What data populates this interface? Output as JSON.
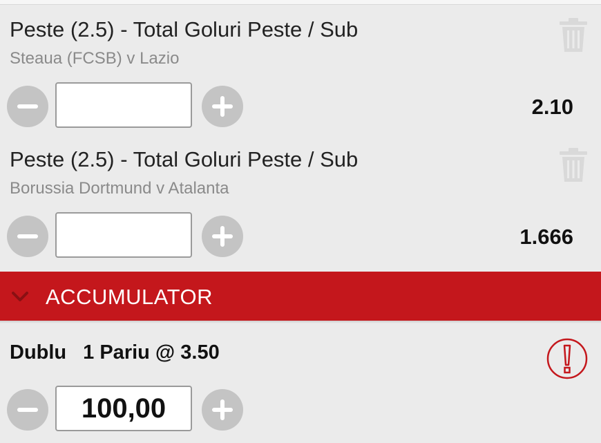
{
  "bets": [
    {
      "market": "Peste (2.5) - Total Goluri Peste / Sub",
      "match": "Steaua (FCSB) v Lazio",
      "stake_value": "",
      "odds": "2.10"
    },
    {
      "market": "Peste (2.5) - Total Goluri Peste / Sub",
      "match": "Borussia Dortmund v Atalanta",
      "stake_value": "",
      "odds": "1.666"
    }
  ],
  "accumulator": {
    "title": "ACCUMULATOR",
    "bet_type": "Dublu",
    "summary": "1 Pariu @ 3.50",
    "stake_value": "100,00"
  },
  "icons": {
    "delete": "trash-icon",
    "decrease": "minus-icon",
    "increase": "plus-icon",
    "collapse": "chevron-down-icon",
    "alert": "exclamation-icon"
  },
  "colors": {
    "accent": "#c4171c",
    "background": "#ebebeb",
    "icon_gray": "#c4c4c4"
  }
}
